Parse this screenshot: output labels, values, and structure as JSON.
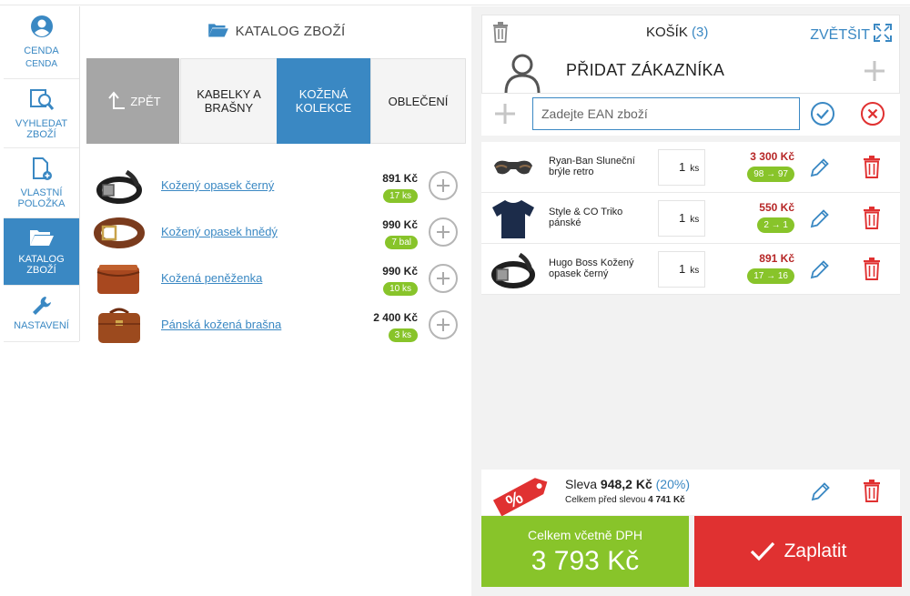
{
  "colors": {
    "accent": "#3a88c3",
    "green": "#88c42a",
    "red": "#e03131",
    "price_red": "#b62626",
    "back_gray": "#a6a6a6"
  },
  "sidebar": {
    "items": [
      {
        "label": "CENDA",
        "sub": "CENDA",
        "icon": "user-icon"
      },
      {
        "label": "VYHLEDAT ZBOŽÍ",
        "icon": "search-product-icon"
      },
      {
        "label": "VLASTNÍ POLOŽKA",
        "icon": "new-document-icon"
      },
      {
        "label": "KATALOG ZBOŽÍ",
        "icon": "folder-open-icon",
        "active": true
      },
      {
        "label": "NASTAVENÍ",
        "icon": "wrench-icon"
      }
    ]
  },
  "catalog": {
    "title": "KATALOG ZBOŽÍ",
    "tabs": [
      {
        "label": "ZPĚT",
        "icon": "back-arrow-icon"
      },
      {
        "label": "KABELKY A BRAŠNY"
      },
      {
        "label": "KOŽENÁ KOLEKCE",
        "selected": true
      },
      {
        "label": "OBLEČENÍ"
      }
    ],
    "products": [
      {
        "name": "Kožený opasek černý",
        "price": "891 Kč",
        "stock": "17 ks",
        "thumb": "black-belt"
      },
      {
        "name": "Kožený opasek hnědý",
        "price": "990 Kč",
        "stock": "7 bal",
        "thumb": "brown-belt"
      },
      {
        "name": "Kožená peněženka",
        "price": "990 Kč",
        "stock": "10 ks",
        "thumb": "wallet"
      },
      {
        "name": "Pánská kožená brašna",
        "price": "2 400 Kč",
        "stock": "3 ks",
        "thumb": "bag"
      }
    ]
  },
  "cart": {
    "title": "KOŠÍK",
    "count": "(3)",
    "zoom_label": "ZVĚTŠIT",
    "add_customer": "PŘIDAT ZÁKAZNÍKA",
    "ean_placeholder": "Zadejte EAN zboží",
    "items": [
      {
        "name": "Ryan-Ban Sluneční brýle retro",
        "qty": "1",
        "unit": "ks",
        "price": "3 300 Kč",
        "stock": "98 → 97",
        "thumb": "sunglasses"
      },
      {
        "name": "Style & CO Triko pánské",
        "qty": "1",
        "unit": "ks",
        "price": "550 Kč",
        "stock": "2 → 1",
        "thumb": "tshirt"
      },
      {
        "name": "Hugo Boss Kožený opasek černý",
        "qty": "1",
        "unit": "ks",
        "price": "891 Kč",
        "stock": "17 → 16",
        "thumb": "black-belt"
      }
    ],
    "discount": {
      "label": "Sleva",
      "amount": "948,2 Kč",
      "percent": "(20%)",
      "before_label": "Celkem před slevou",
      "before_amount": "4 741 Kč",
      "tag_text": "%"
    },
    "total": {
      "label": "Celkem včetně DPH",
      "value": "3 793 Kč"
    },
    "pay_label": "Zaplatit"
  }
}
